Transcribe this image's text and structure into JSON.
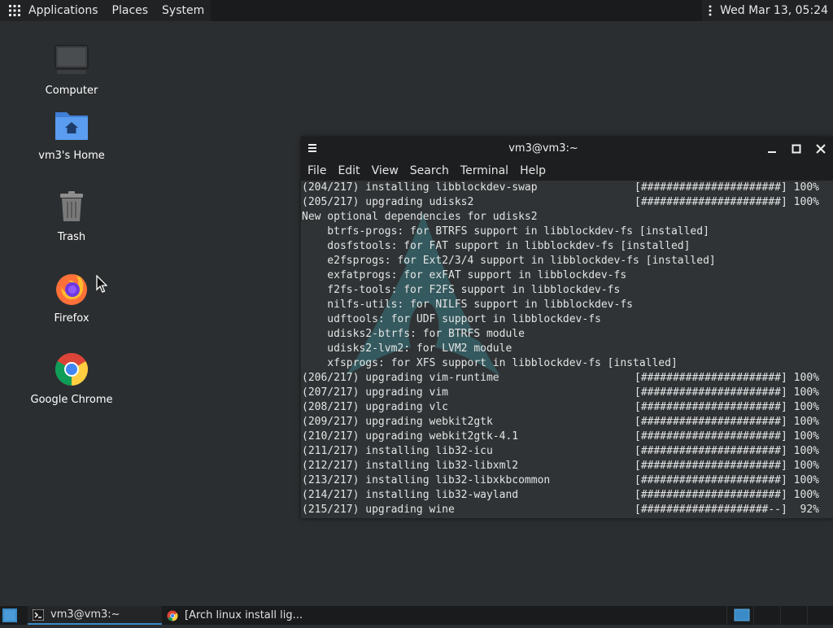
{
  "top_panel": {
    "menus": [
      "Applications",
      "Places",
      "System"
    ],
    "clock": "Wed Mar 13, 05:24"
  },
  "desktop": {
    "icons": [
      {
        "label": "Computer",
        "icon": "computer-icon"
      },
      {
        "label": "vm3's Home",
        "icon": "home-folder-icon"
      },
      {
        "label": "Trash",
        "icon": "trash-icon"
      },
      {
        "label": "Firefox",
        "icon": "firefox-icon"
      },
      {
        "label": "Google Chrome",
        "icon": "chrome-icon"
      }
    ]
  },
  "terminal": {
    "title": "vm3@vm3:~",
    "menu": [
      "File",
      "Edit",
      "View",
      "Search",
      "Terminal",
      "Help"
    ],
    "lines": [
      {
        "left": "(204/217) installing libblockdev-swap",
        "right": "[######################] 100%"
      },
      {
        "left": "(205/217) upgrading udisks2",
        "right": "[######################] 100%"
      },
      {
        "left": "New optional dependencies for udisks2",
        "right": ""
      },
      {
        "left": "    btrfs-progs: for BTRFS support in libblockdev-fs [installed]",
        "right": ""
      },
      {
        "left": "    dosfstools: for FAT support in libblockdev-fs [installed]",
        "right": ""
      },
      {
        "left": "    e2fsprogs: for Ext2/3/4 support in libblockdev-fs [installed]",
        "right": ""
      },
      {
        "left": "    exfatprogs: for exFAT support in libblockdev-fs",
        "right": ""
      },
      {
        "left": "    f2fs-tools: for F2FS support in libblockdev-fs",
        "right": ""
      },
      {
        "left": "    nilfs-utils: for NILFS support in libblockdev-fs",
        "right": ""
      },
      {
        "left": "    udftools: for UDF support in libblockdev-fs",
        "right": ""
      },
      {
        "left": "    udisks2-btrfs: for BTRFS module",
        "right": ""
      },
      {
        "left": "    udisks2-lvm2: for LVM2 module",
        "right": ""
      },
      {
        "left": "    xfsprogs: for XFS support in libblockdev-fs [installed]",
        "right": ""
      },
      {
        "left": "(206/217) upgrading vim-runtime",
        "right": "[######################] 100%"
      },
      {
        "left": "(207/217) upgrading vim",
        "right": "[######################] 100%"
      },
      {
        "left": "(208/217) upgrading vlc",
        "right": "[######################] 100%"
      },
      {
        "left": "(209/217) upgrading webkit2gtk",
        "right": "[######################] 100%"
      },
      {
        "left": "(210/217) upgrading webkit2gtk-4.1",
        "right": "[######################] 100%"
      },
      {
        "left": "(211/217) installing lib32-icu",
        "right": "[######################] 100%"
      },
      {
        "left": "(212/217) installing lib32-libxml2",
        "right": "[######################] 100%"
      },
      {
        "left": "(213/217) installing lib32-libxkbcommon",
        "right": "[######################] 100%"
      },
      {
        "left": "(214/217) installing lib32-wayland",
        "right": "[######################] 100%"
      },
      {
        "left": "(215/217) upgrading wine",
        "right": "[####################--]  92%"
      }
    ]
  },
  "taskbar": {
    "tasks": [
      {
        "label": "vm3@vm3:~",
        "icon": "terminal-icon"
      },
      {
        "label": "[Arch linux install lig...",
        "icon": "chrome-icon"
      }
    ]
  },
  "colors": {
    "desktop_bg": "#2b2e30",
    "panel_bg": "#191b1c",
    "accent": "#3a8bc8"
  }
}
